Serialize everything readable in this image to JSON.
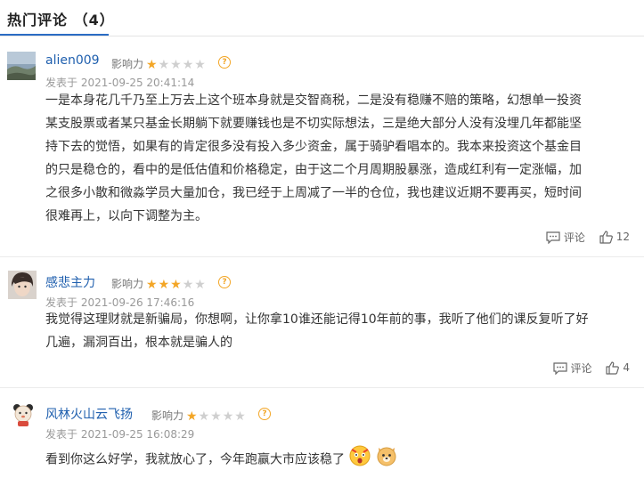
{
  "header": {
    "title": "热门评论 （4）"
  },
  "labels": {
    "influence": "影响力",
    "posted_prefix": "发表于",
    "comment_action": "评论"
  },
  "colors": {
    "accent": "#2b6cc4",
    "username": "#1f5fae",
    "star_on": "#f3a626",
    "star_off": "#cfcfcf"
  },
  "comments": [
    {
      "username": "alien009",
      "rating": 1,
      "rating_max": 5,
      "posted_at": "2021-09-25 20:41:14",
      "lines": [
        "一是本身花几千乃至上万去上这个班本身就是交智商税，二是没有稳赚不赔的策略，幻想单一投资",
        "某支股票或者某只基金长期躺下就要赚钱也是不切实际想法，三是绝大部分人没有没埋几年都能坚",
        "持下去的觉悟，如果有的肯定很多没有投入多少资金，属于骑驴看唱本的。我本来投资这个基金目",
        "的只是稳仓的，看中的是低估值和价格稳定，由于这二个月周期股暴涨，造成红利有一定涨幅，加",
        "之很多小散和微淼学员大量加仓，我已经于上周减了一半的仓位，我也建议近期不要再买，短时间",
        "很难再上，以向下调整为主。"
      ],
      "likes": "12"
    },
    {
      "username": "感悲主力",
      "rating": 3,
      "rating_max": 5,
      "posted_at": "2021-09-26 17:46:16",
      "lines": [
        "我觉得这理财就是新骗局，你想啊，让你拿10谁还能记得10年前的事，我听了他们的课反复听了好",
        "几遍，漏洞百出，根本就是骗人的"
      ],
      "likes": "4"
    },
    {
      "username": "风林火山云飞扬",
      "rating": 1,
      "rating_max": 5,
      "posted_at": "2021-09-25 16:08:29",
      "lines": [
        "看到你这么好学，我就放心了，今年跑赢大市应该稳了"
      ],
      "emojis": [
        "surprised-face-emoji",
        "dog-face-emoji"
      ]
    }
  ]
}
